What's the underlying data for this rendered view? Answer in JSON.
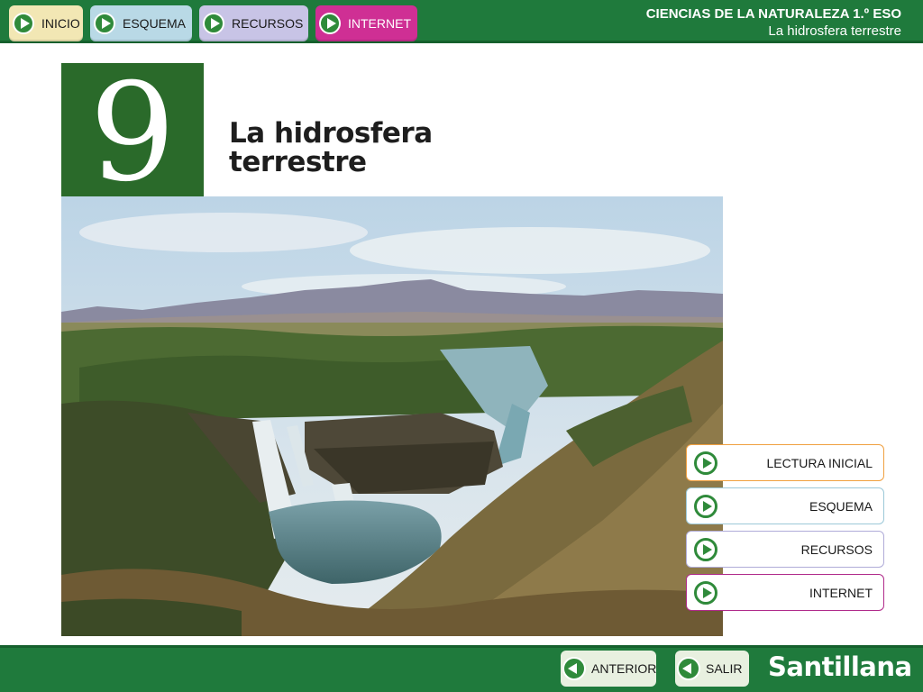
{
  "topnav": {
    "items": [
      {
        "label": "INICIO"
      },
      {
        "label": "ESQUEMA"
      },
      {
        "label": "RECURSOS"
      },
      {
        "label": "INTERNET"
      }
    ]
  },
  "header": {
    "title": "CIENCIAS DE LA NATURALEZA 1.º ESO",
    "subtitle": "La hidrosfera terrestre"
  },
  "chapter": {
    "number": "9",
    "title_line1": "La hidrosfera",
    "title_line2": "terrestre"
  },
  "sidemenu": {
    "items": [
      {
        "label": "LECTURA INICIAL"
      },
      {
        "label": "ESQUEMA"
      },
      {
        "label": "RECURSOS"
      },
      {
        "label": "INTERNET"
      }
    ]
  },
  "footer": {
    "prev_label": "ANTERIOR",
    "exit_label": "SALIR",
    "logo": "Santillana"
  },
  "colors": {
    "bar_green": "#1f7a3c",
    "chapter_green": "#2a6a2a",
    "accent_magenta": "#cf2f94",
    "accent_orange": "#f0a040"
  },
  "icons": {
    "nav": "play-icon",
    "back": "back-arrow-icon"
  }
}
